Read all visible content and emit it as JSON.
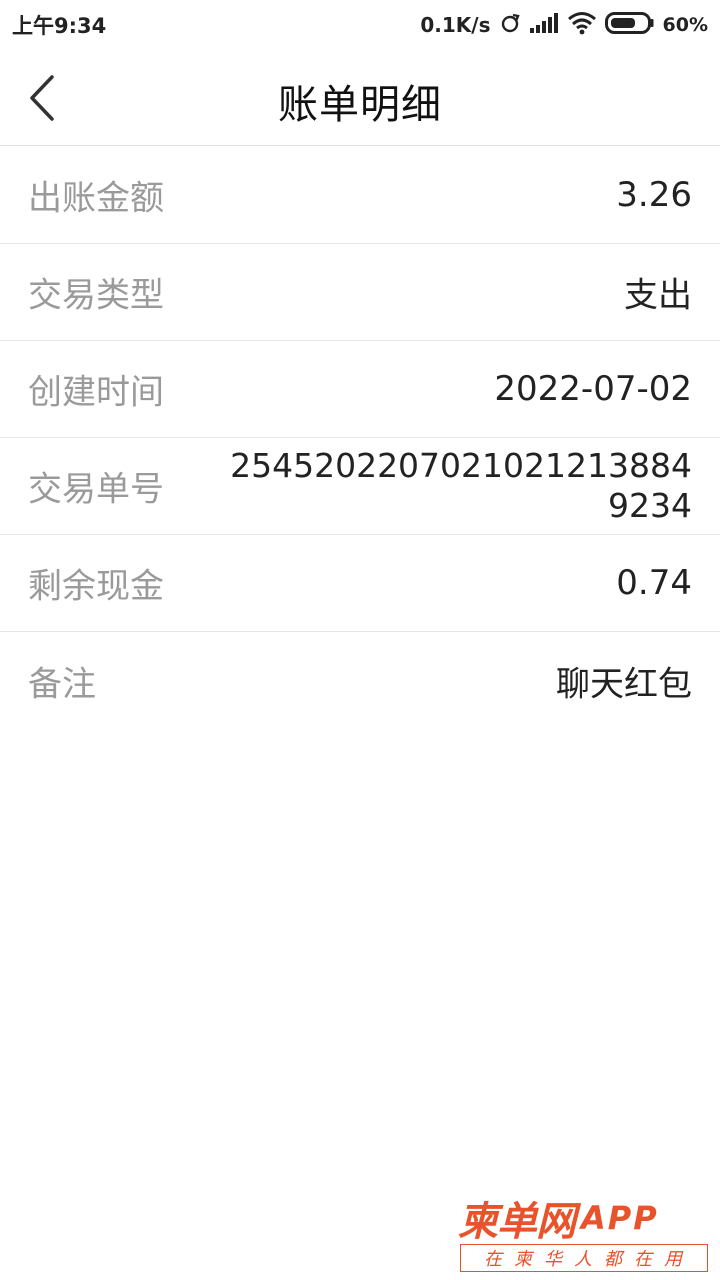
{
  "status_bar": {
    "time": "上午9:34",
    "net_speed": "0.1K/s",
    "battery": "60%",
    "icons": [
      "sync-icon",
      "signal-icon",
      "wifi-icon",
      "battery-icon"
    ]
  },
  "header": {
    "title": "账单明细",
    "back_icon": "chevron-left-icon"
  },
  "details": [
    {
      "label": "出账金额",
      "value": "3.26"
    },
    {
      "label": "交易类型",
      "value": "支出"
    },
    {
      "label": "创建时间",
      "value": "2022-07-02"
    },
    {
      "label": "交易单号",
      "value": "25452022070210212138849234"
    },
    {
      "label": "剩余现金",
      "value": "0.74"
    },
    {
      "label": "备注",
      "value": "聊天红包"
    }
  ],
  "watermark": {
    "brand": "柬单网",
    "app": "APP",
    "slogan": "在柬华人都在用"
  },
  "colors": {
    "label": "#9a9a9a",
    "value": "#222222",
    "divider": "#e6e6e6",
    "watermark": "#e8532b"
  }
}
